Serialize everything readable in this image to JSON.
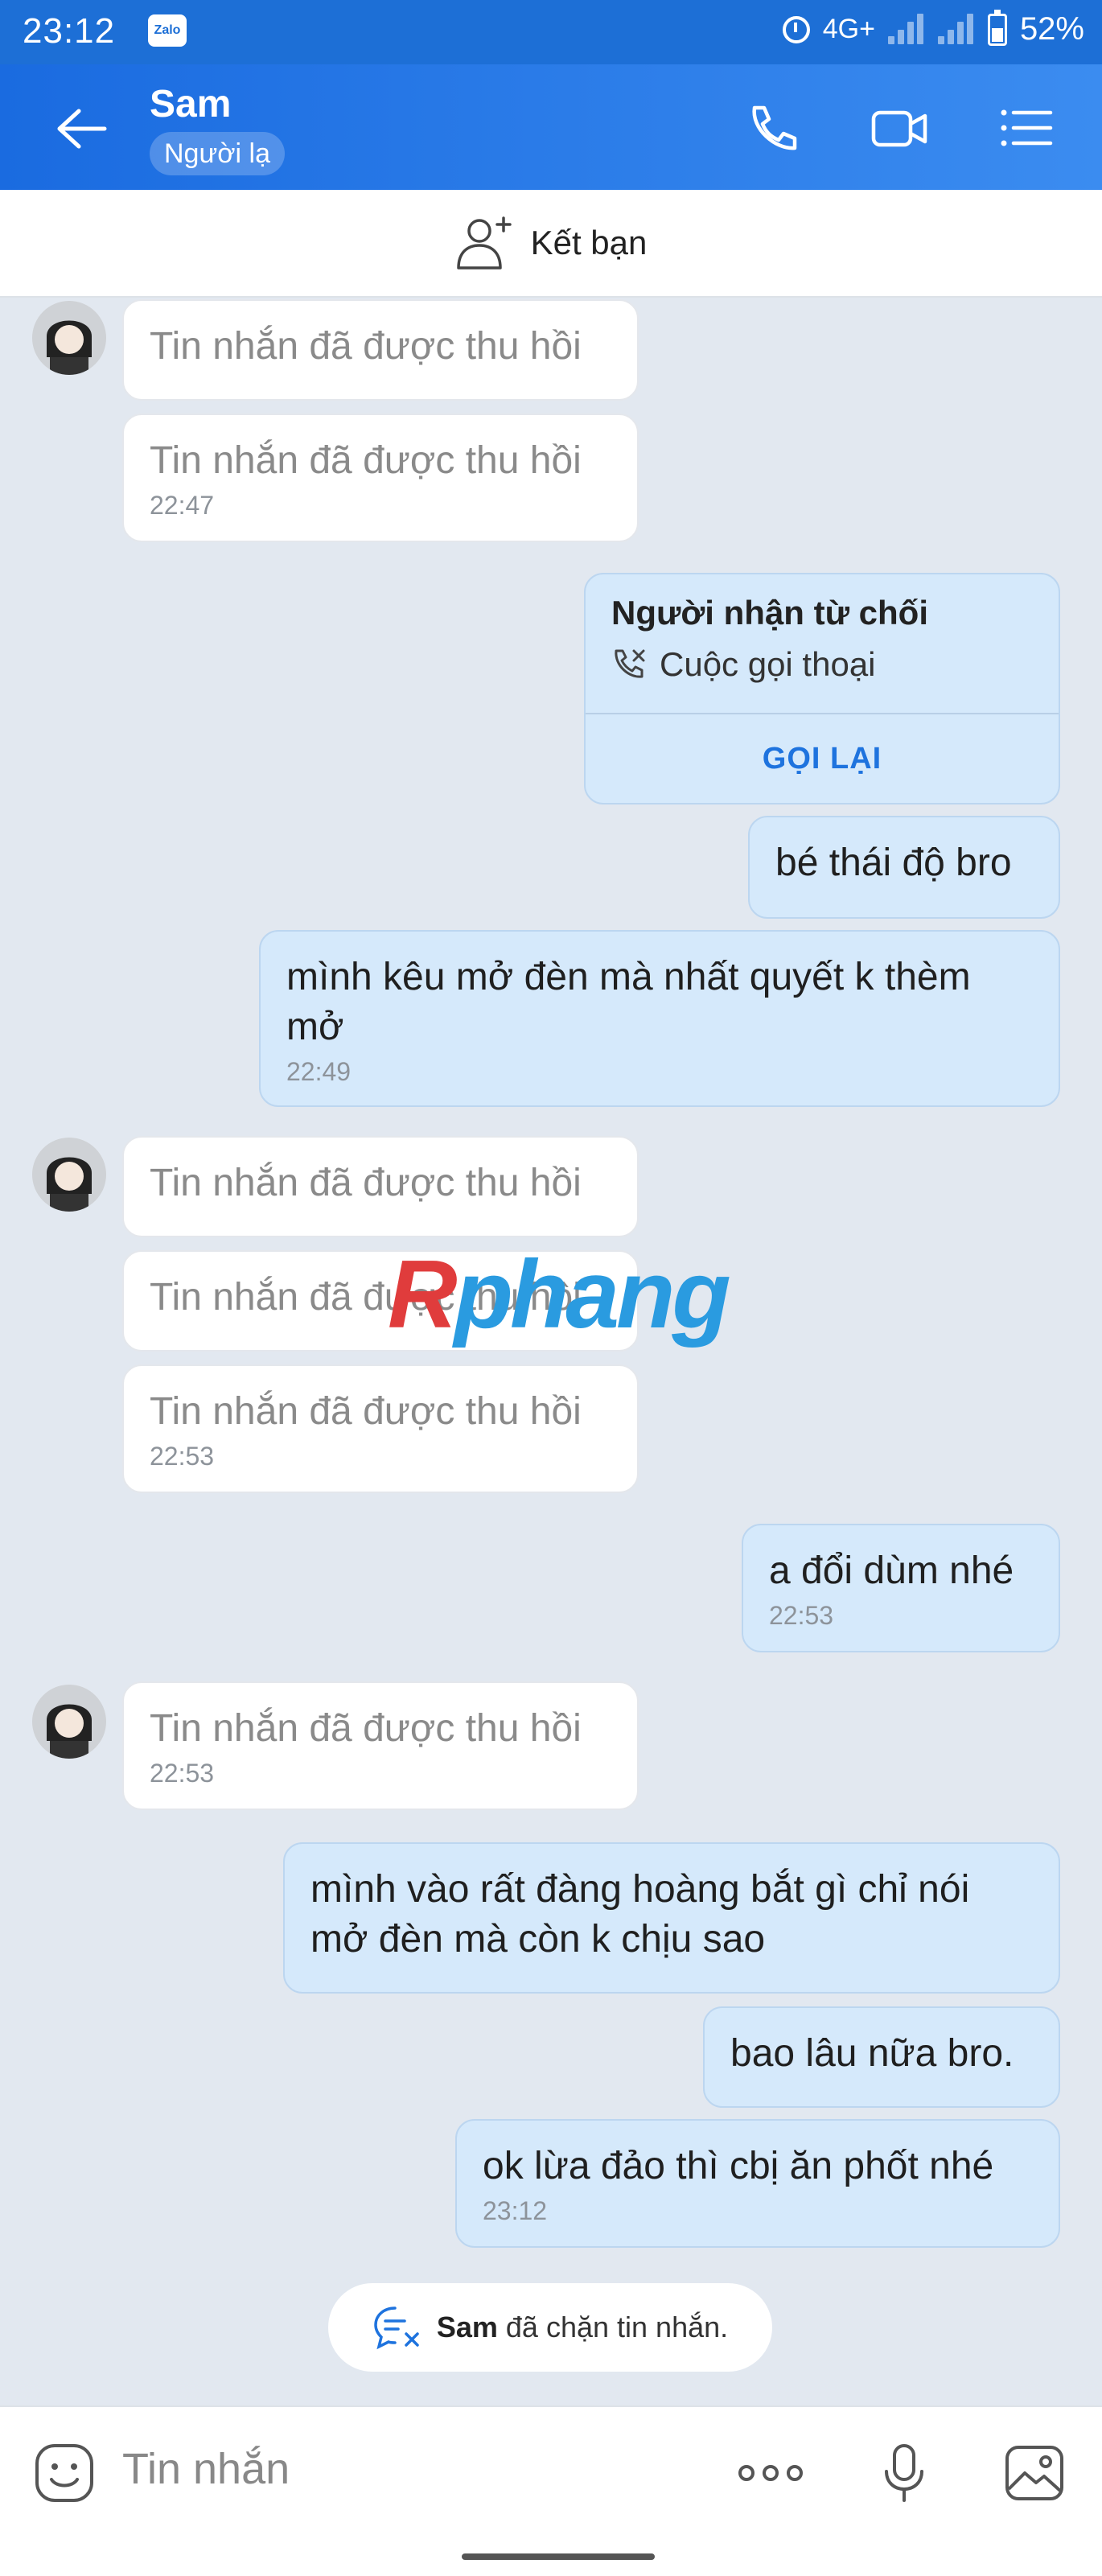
{
  "status_bar": {
    "time": "23:12",
    "app_icon_label": "Zalo",
    "network": "4G+",
    "battery": "52%"
  },
  "header": {
    "name": "Sam",
    "badge": "Người lạ"
  },
  "friend_bar": {
    "label": "Kết bạn"
  },
  "messages": [
    {
      "dir": "in",
      "text": "Tin nhắn đã được thu hồi",
      "time": ""
    },
    {
      "dir": "in",
      "text": "Tin nhắn đã được thu hồi",
      "time": "22:47"
    },
    {
      "dir": "out",
      "text": "bé thái độ bro",
      "time": ""
    },
    {
      "dir": "out",
      "text": "mình kêu mở đèn mà nhất quyết k thèm mở",
      "time": "22:49"
    },
    {
      "dir": "in",
      "text": "Tin nhắn đã được thu hồi",
      "time": ""
    },
    {
      "dir": "in",
      "text": "Tin nhắn đã được thu hồi",
      "time": ""
    },
    {
      "dir": "in",
      "text": "Tin nhắn đã được thu hồi",
      "time": "22:53"
    },
    {
      "dir": "out",
      "text": "a đổi dùm nhé",
      "time": "22:53"
    },
    {
      "dir": "in",
      "text": "Tin nhắn đã được thu hồi",
      "time": "22:53"
    },
    {
      "dir": "out",
      "text": "mình vào rất đàng hoàng bắt gì chỉ nói mở đèn mà còn k chịu sao",
      "time": ""
    },
    {
      "dir": "out",
      "text": "bao lâu nữa bro.",
      "time": ""
    },
    {
      "dir": "out",
      "text": "ok lừa đảo thì cbị ăn phốt nhé",
      "time": "23:12"
    }
  ],
  "call_card": {
    "title": "Người nhận từ chối",
    "subtitle": "Cuộc gọi thoại",
    "action": "GỌI LẠI"
  },
  "watermark": {
    "part1": "R",
    "part2": "phang"
  },
  "blocked_notice": {
    "name": "Sam",
    "text": " đã chặn tin nhắn."
  },
  "input": {
    "placeholder": "Tin nhắn"
  },
  "colors": {
    "header": "#1a6be0",
    "outgoing_bubble": "#d5e9fb",
    "incoming_bubble": "#ffffff",
    "accent": "#1e73de"
  }
}
